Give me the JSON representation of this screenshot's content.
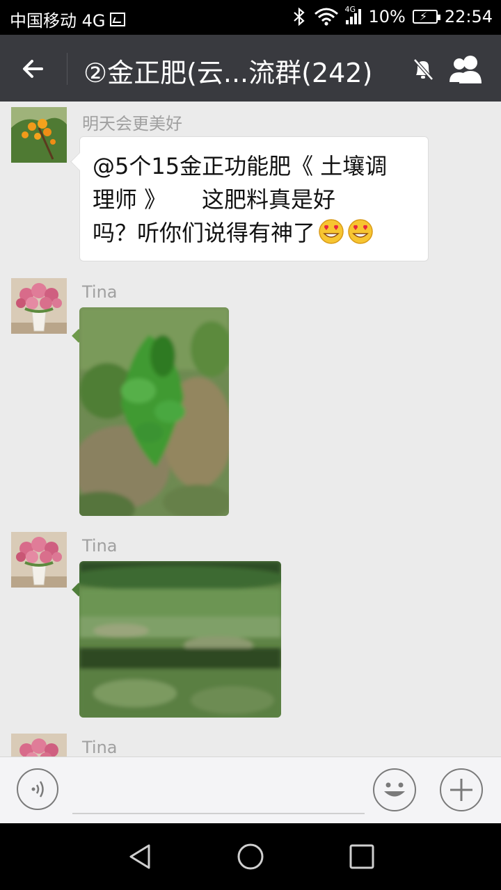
{
  "status_bar": {
    "carrier": "中国移动 4G",
    "network_badge": "4G",
    "battery": "10%",
    "time": "22:54"
  },
  "header": {
    "title": "②金正肥(云...流群(242)",
    "icons": [
      "back-arrow-icon",
      "mute-bell-icon",
      "group-members-icon"
    ]
  },
  "messages": [
    {
      "sender": "明天会更美好",
      "type": "text",
      "lines": [
        "@5个15金正功能肥《 土壤调",
        "理师 》     这肥料真是好",
        "吗？听你们说得有神了"
      ],
      "emoji": [
        "heart-eyes-emoji",
        "heart-eyes-emoji"
      ]
    },
    {
      "sender": "Tina",
      "type": "image",
      "image_desc": "young citrus seedling in grass"
    },
    {
      "sender": "Tina",
      "type": "image",
      "image_desc": "field of grass and shrubs"
    },
    {
      "sender": "Tina",
      "type": "image"
    }
  ],
  "input_bar": {
    "icons": [
      "voice-icon",
      "emoji-icon",
      "plus-icon"
    ]
  },
  "nav_bar": {
    "icons": [
      "back-triangle-icon",
      "home-circle-icon",
      "recents-square-icon"
    ]
  },
  "colors": {
    "title_bar": "#393a3f",
    "chat_bg": "#ebebeb",
    "sender_text": "#a0a0a0"
  }
}
